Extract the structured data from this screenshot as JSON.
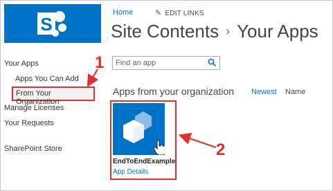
{
  "header": {
    "home_link": "Home",
    "edit_links": "EDIT LINKS",
    "title_part1": "Site Contents",
    "title_separator": "›",
    "title_part2": "Your Apps"
  },
  "sidebar": {
    "items": [
      {
        "label": "Your Apps"
      },
      {
        "label": "Apps You Can Add"
      },
      {
        "label": "From Your Organization",
        "selected": true
      },
      {
        "label": "Manage Licenses"
      },
      {
        "label": "Your Requests"
      },
      {
        "label": "SharePoint Store"
      }
    ]
  },
  "search": {
    "placeholder": "Find an app",
    "value": ""
  },
  "section": {
    "heading": "Apps from your organization",
    "sort_newest": "Newest",
    "sort_name": "Name"
  },
  "app_tile": {
    "title": "EndToEndExample",
    "details_link": "App Details"
  },
  "annotations": {
    "step_1": "1",
    "step_2": "2"
  },
  "colors": {
    "brand_blue": "#0072c6",
    "annotation_red": "#e03030"
  },
  "icons": {
    "logo": "sharepoint-logo",
    "edit": "pencil-icon",
    "search": "search-icon",
    "app": "cubes-icon",
    "cursor": "hand-cursor-icon"
  }
}
